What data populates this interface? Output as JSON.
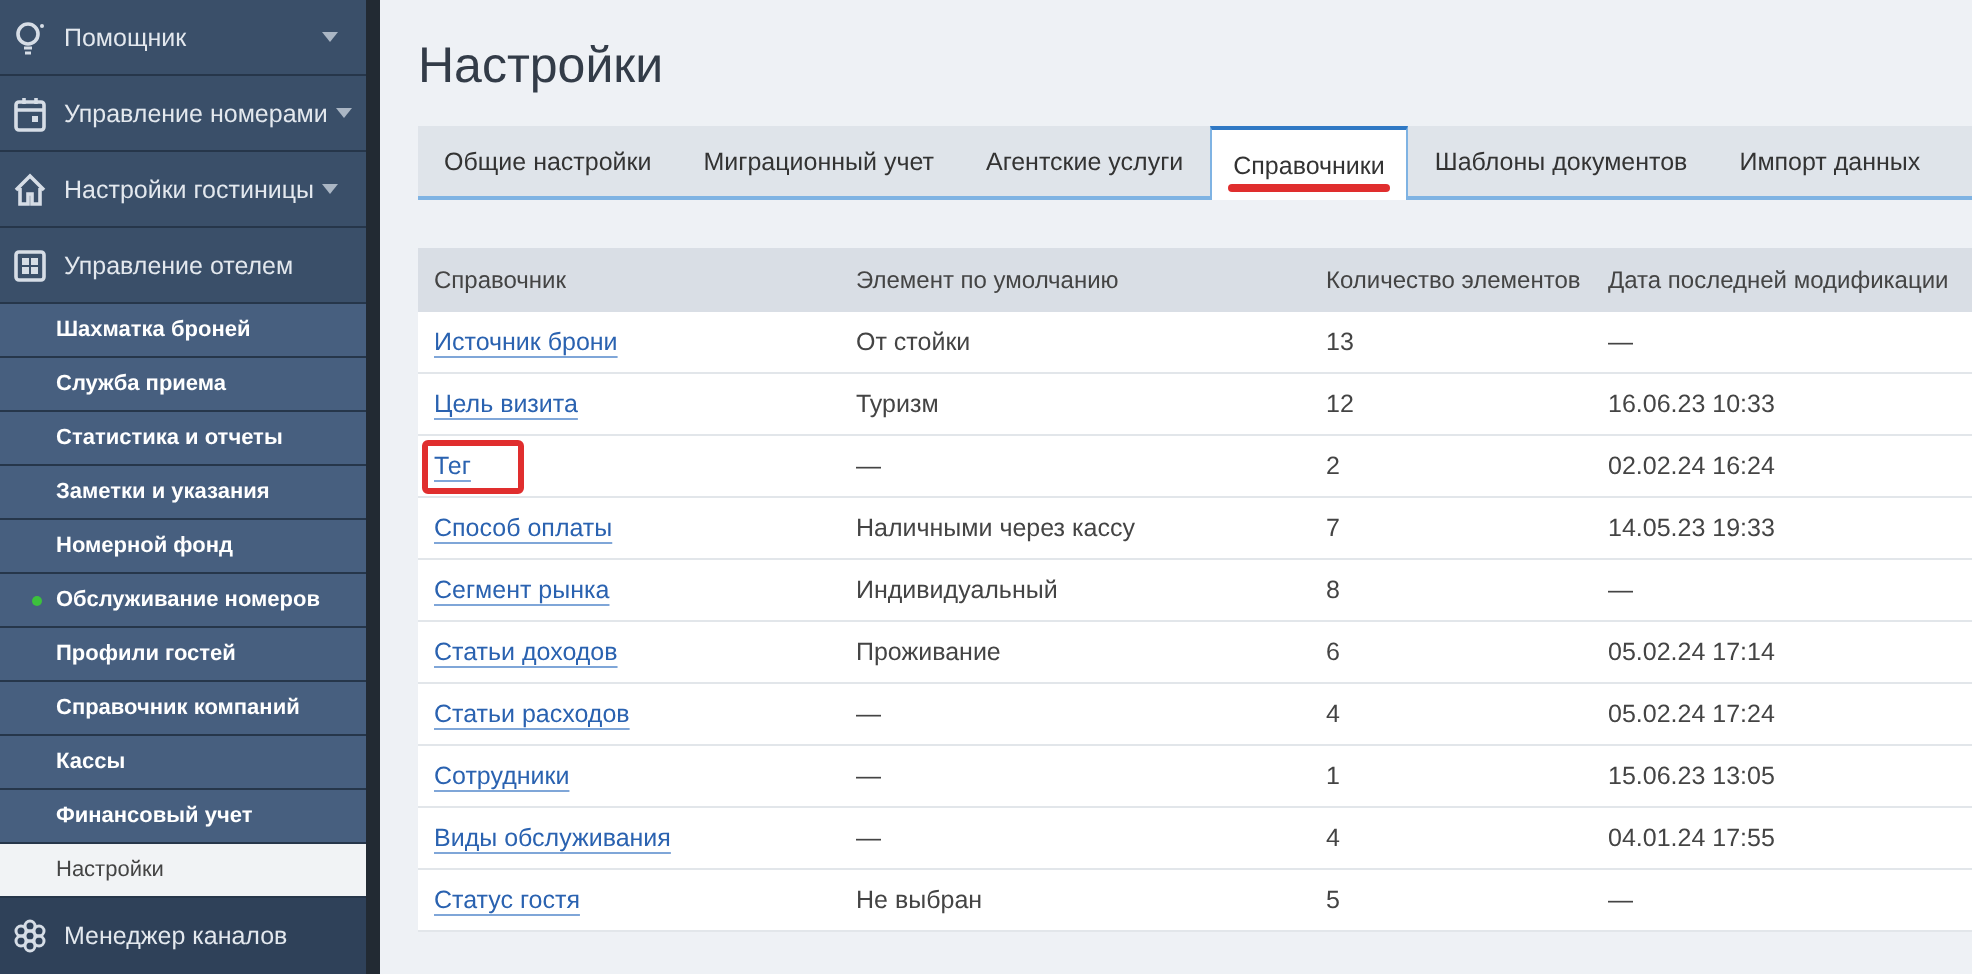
{
  "sidebar": {
    "sections": [
      {
        "label": "Помощник",
        "expandable": true,
        "expanded": false
      },
      {
        "label": "Управление номерами",
        "expandable": true,
        "expanded": false
      },
      {
        "label": "Настройки гостиницы",
        "expandable": true,
        "expanded": false
      },
      {
        "label": "Управление отелем",
        "expandable": false,
        "expanded": true,
        "children": [
          {
            "label": "Шахматка броней",
            "selected": false,
            "marked": false
          },
          {
            "label": "Служба приема",
            "selected": false,
            "marked": false
          },
          {
            "label": "Статистика и отчеты",
            "selected": false,
            "marked": false
          },
          {
            "label": "Заметки и указания",
            "selected": false,
            "marked": false
          },
          {
            "label": "Номерной фонд",
            "selected": false,
            "marked": false
          },
          {
            "label": "Обслуживание номеров",
            "selected": false,
            "marked": true
          },
          {
            "label": "Профили гостей",
            "selected": false,
            "marked": false
          },
          {
            "label": "Справочник компаний",
            "selected": false,
            "marked": false
          },
          {
            "label": "Кассы",
            "selected": false,
            "marked": false
          },
          {
            "label": "Финансовый учет",
            "selected": false,
            "marked": false
          },
          {
            "label": "Настройки",
            "selected": true,
            "marked": false
          }
        ]
      },
      {
        "label": "Менеджер каналов",
        "expandable": false,
        "expanded": false
      }
    ]
  },
  "page": {
    "title": "Настройки"
  },
  "tabs": [
    {
      "label": "Общие настройки",
      "selected": false,
      "highlighted": false
    },
    {
      "label": "Миграционный учет",
      "selected": false,
      "highlighted": false
    },
    {
      "label": "Агентские услуги",
      "selected": false,
      "highlighted": false
    },
    {
      "label": "Справочники",
      "selected": true,
      "highlighted": true
    },
    {
      "label": "Шаблоны документов",
      "selected": false,
      "highlighted": false
    },
    {
      "label": "Импорт данных",
      "selected": false,
      "highlighted": false
    }
  ],
  "table": {
    "columns": [
      "Справочник",
      "Элемент по умолчанию",
      "Количество элементов",
      "Дата последней модификации"
    ],
    "rows": [
      {
        "name": "Источник брони",
        "default": "От стойки",
        "count": "13",
        "modified": "—",
        "highlighted": false
      },
      {
        "name": "Цель визита",
        "default": "Туризм",
        "count": "12",
        "modified": "16.06.23 10:33",
        "highlighted": false
      },
      {
        "name": "Тег",
        "default": "—",
        "count": "2",
        "modified": "02.02.24 16:24",
        "highlighted": true
      },
      {
        "name": "Способ оплаты",
        "default": "Наличными через кассу",
        "count": "7",
        "modified": "14.05.23 19:33",
        "highlighted": false
      },
      {
        "name": "Сегмент рынка",
        "default": "Индивидуальный",
        "count": "8",
        "modified": "—",
        "highlighted": false
      },
      {
        "name": "Статьи доходов",
        "default": "Проживание",
        "count": "6",
        "modified": "05.02.24 17:14",
        "highlighted": false
      },
      {
        "name": "Статьи расходов",
        "default": "—",
        "count": "4",
        "modified": "05.02.24 17:24",
        "highlighted": false
      },
      {
        "name": "Сотрудники",
        "default": "—",
        "count": "1",
        "modified": "15.06.23 13:05",
        "highlighted": false
      },
      {
        "name": "Виды обслуживания",
        "default": "—",
        "count": "4",
        "modified": "04.01.24 17:55",
        "highlighted": false
      },
      {
        "name": "Статус гостя",
        "default": "Не выбран",
        "count": "5",
        "modified": "—",
        "highlighted": false
      }
    ]
  }
}
